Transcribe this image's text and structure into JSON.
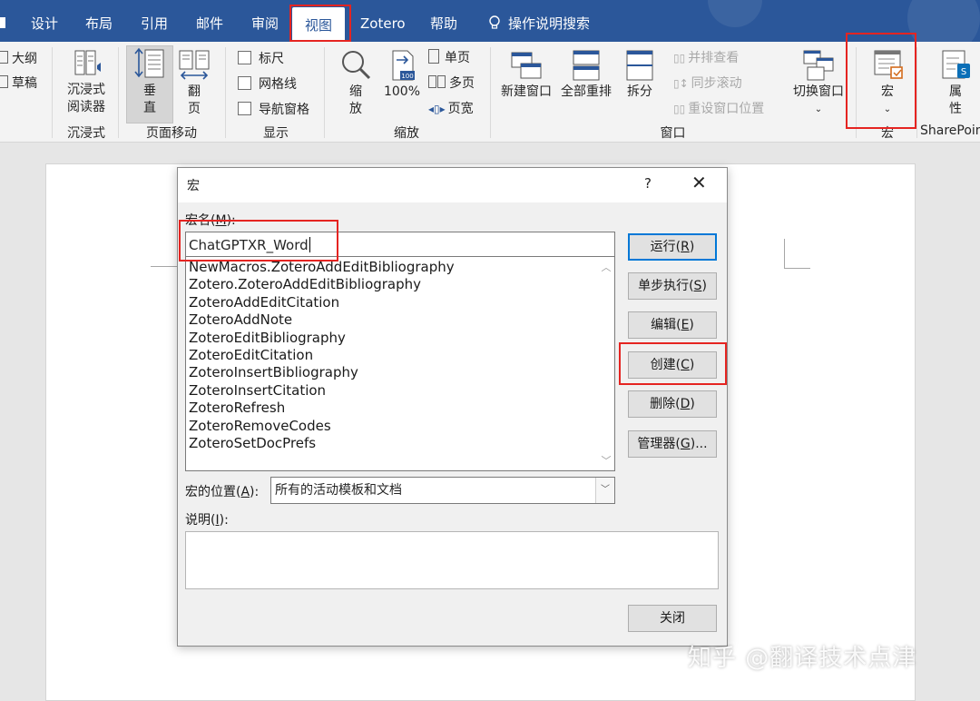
{
  "tabs": [
    "设计",
    "布局",
    "引用",
    "邮件",
    "审阅",
    "视图",
    "Zotero",
    "帮助",
    "操作说明搜索"
  ],
  "ribbon": {
    "outline": "大纲",
    "draft": "草稿",
    "immersive_reader": [
      "沉浸式",
      "阅读器"
    ],
    "immersive_group": "沉浸式",
    "vertical": [
      "垂",
      "直"
    ],
    "side_to_side": [
      "翻",
      "页"
    ],
    "page_move_group": "页面移动",
    "ruler": "标尺",
    "gridlines": "网格线",
    "nav_pane": "导航窗格",
    "show_group": "显示",
    "zoom": [
      "缩",
      "放"
    ],
    "zoom_100": "100%",
    "one_page": "单页",
    "multi_page": "多页",
    "page_width": "页宽",
    "zoom_group": "缩放",
    "new_window": "新建窗口",
    "arrange_all": "全部重排",
    "split": "拆分",
    "side_by_side": "并排查看",
    "sync_scroll": "同步滚动",
    "reset_pos": "重设窗口位置",
    "switch_window": "切换窗口",
    "window_group": "窗口",
    "macros": "宏",
    "macros_group": "宏",
    "properties": [
      "属",
      "性"
    ],
    "sharepoint_group": "SharePoin"
  },
  "dialog": {
    "title": "宏",
    "help": "?",
    "close_x": "✕",
    "macro_name_label": "宏名(",
    "macro_name_key": "M",
    "macro_name_suffix": "):",
    "macro_name_value": "ChatGPTXR_Word",
    "macro_list": [
      "NewMacros.ZoteroAddEditBibliography",
      "Zotero.ZoteroAddEditBibliography",
      "ZoteroAddEditCitation",
      "ZoteroAddNote",
      "ZoteroEditBibliography",
      "ZoteroEditCitation",
      "ZoteroInsertBibliography",
      "ZoteroInsertCitation",
      "ZoteroRefresh",
      "ZoteroRemoveCodes",
      "ZoteroSetDocPrefs"
    ],
    "buttons": {
      "run": [
        "运行(",
        "R",
        ")"
      ],
      "step": [
        "单步执行(",
        "S",
        ")"
      ],
      "edit": [
        "编辑(",
        "E",
        ")"
      ],
      "create": [
        "创建(",
        "C",
        ")"
      ],
      "delete": [
        "删除(",
        "D",
        ")"
      ],
      "organizer": [
        "管理器(",
        "G",
        ")..."
      ],
      "close": "关闭"
    },
    "location_label": [
      "宏的位置(",
      "A",
      "):"
    ],
    "location_value": "所有的活动模板和文档",
    "description_label": [
      "说明(",
      "I",
      "):"
    ]
  },
  "watermark": "知乎 @翻译技术点津",
  "colors": {
    "ribbon_blue": "#2b579a",
    "highlight_red": "#e52421",
    "focus_blue": "#0078d7"
  }
}
